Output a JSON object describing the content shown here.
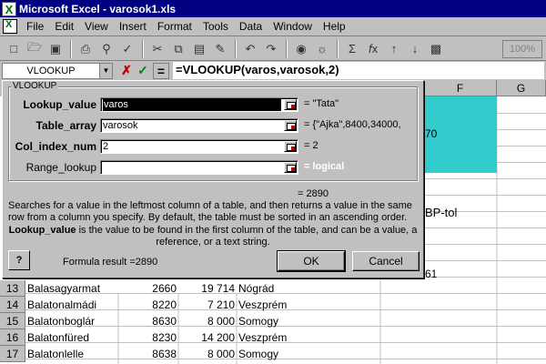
{
  "window": {
    "title": "Microsoft Excel - varosok1.xls"
  },
  "menu": [
    "File",
    "Edit",
    "View",
    "Insert",
    "Format",
    "Tools",
    "Data",
    "Window",
    "Help"
  ],
  "toolbar": {
    "zoom": "100%",
    "icons": [
      "new-icon",
      "open-icon",
      "save-icon",
      "print-icon",
      "print-preview-icon",
      "spelling-icon",
      "cut-icon",
      "copy-icon",
      "paste-icon",
      "format-painter-icon",
      "undo-icon",
      "redo-icon",
      "hyperlink-icon",
      "web-toolbar-icon",
      "autosum-icon",
      "paste-function-icon",
      "sort-ascending-icon",
      "sort-descending-icon",
      "chart-wizard-icon"
    ]
  },
  "formula_bar": {
    "name_box": "VLOOKUP",
    "formula": "=VLOOKUP(varos,varosok,2)"
  },
  "columns": [
    "F",
    "G"
  ],
  "dialog": {
    "title": "VLOOKUP",
    "args": [
      {
        "label": "Lookup_value",
        "value": "varos",
        "result": "= \"Tata\""
      },
      {
        "label": "Table_array",
        "value": "varosok",
        "result": "= {\"Ajka\",8400,34000,"
      },
      {
        "label": "Col_index_num",
        "value": "2",
        "result": "= 2"
      },
      {
        "label": "Range_lookup",
        "value": "",
        "result": "= logical"
      }
    ],
    "total": "= 2890",
    "description": "Searches for a value in the leftmost column of a table, and then returns a value in the same row from a column you specify. By default, the table must be sorted in an ascending order.",
    "arg_name": "Lookup_value",
    "arg_description": "is the value to be found in the first column of the table, and can be a value, a reference, or a text string.",
    "formula_result": "Formula result =2890",
    "help": "?",
    "ok": "OK",
    "cancel": "Cancel"
  },
  "peek_cells": {
    "f_70": "70",
    "bp_tol": "BP-tol",
    "val_61": "61"
  },
  "rows": [
    {
      "n": "13",
      "city": "Balasagyarmat",
      "zip": "2660",
      "pop": "19 714",
      "county": "Nógrád"
    },
    {
      "n": "14",
      "city": "Balatonalmádi",
      "zip": "8220",
      "pop": "7 210",
      "county": "Veszprém"
    },
    {
      "n": "15",
      "city": "Balatonboglár",
      "zip": "8630",
      "pop": "8 000",
      "county": "Somogy"
    },
    {
      "n": "16",
      "city": "Balatonfüred",
      "zip": "8230",
      "pop": "14 200",
      "county": "Veszprém"
    },
    {
      "n": "17",
      "city": "Balatonlelle",
      "zip": "8638",
      "pop": "8 000",
      "county": "Somogy"
    }
  ]
}
